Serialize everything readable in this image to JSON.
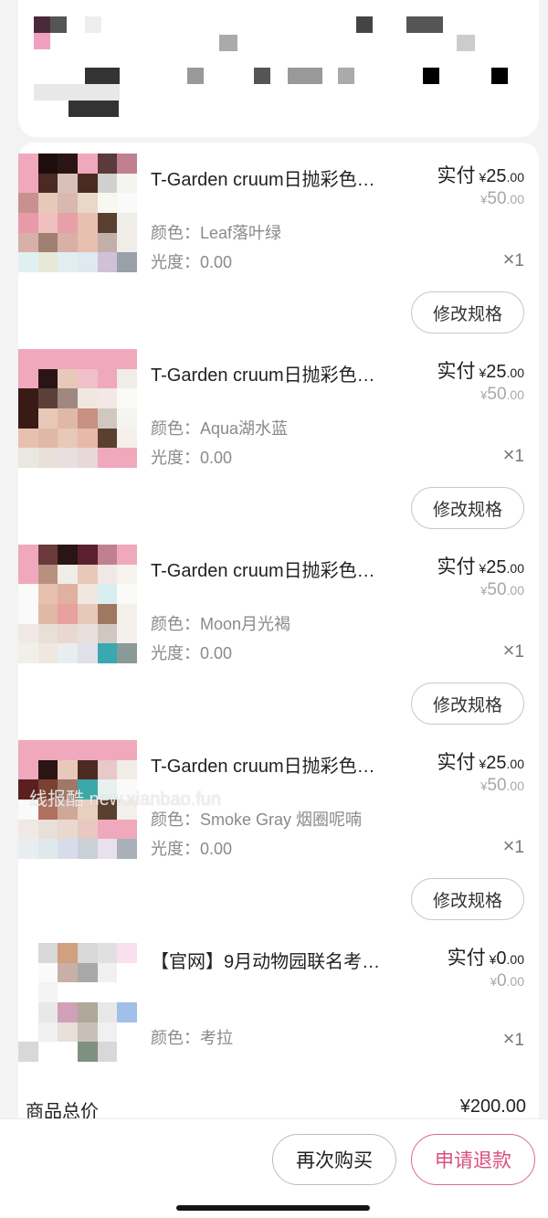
{
  "orders": [
    {
      "title": "T-Garden cruum日抛彩色…",
      "paid_label": "实付",
      "currency": "¥",
      "paid_int": "25",
      "paid_dec": ".00",
      "orig_int": "50",
      "orig_dec": ".00",
      "color_label": "颜色：",
      "color_value": "Leaf落叶绿",
      "power_label": "光度：",
      "power_value": "0.00",
      "qty_x": "×",
      "qty": "1",
      "modify_label": "修改规格"
    },
    {
      "title": "T-Garden cruum日抛彩色…",
      "paid_label": "实付",
      "currency": "¥",
      "paid_int": "25",
      "paid_dec": ".00",
      "orig_int": "50",
      "orig_dec": ".00",
      "color_label": "颜色：",
      "color_value": "Aqua湖水蓝",
      "power_label": "光度：",
      "power_value": "0.00",
      "qty_x": "×",
      "qty": "1",
      "modify_label": "修改规格"
    },
    {
      "title": "T-Garden cruum日抛彩色…",
      "paid_label": "实付",
      "currency": "¥",
      "paid_int": "25",
      "paid_dec": ".00",
      "orig_int": "50",
      "orig_dec": ".00",
      "color_label": "颜色：",
      "color_value": "Moon月光褐",
      "power_label": "光度：",
      "power_value": "0.00",
      "qty_x": "×",
      "qty": "1",
      "modify_label": "修改规格"
    },
    {
      "title": "T-Garden cruum日抛彩色…",
      "paid_label": "实付",
      "currency": "¥",
      "paid_int": "25",
      "paid_dec": ".00",
      "orig_int": "50",
      "orig_dec": ".00",
      "color_label": "颜色：",
      "color_value": "Smoke Gray 烟圈呢喃",
      "power_label": "光度：",
      "power_value": "0.00",
      "qty_x": "×",
      "qty": "1",
      "modify_label": "修改规格"
    },
    {
      "title": "【官网】9月动物园联名考…",
      "paid_label": "实付",
      "currency": "¥",
      "paid_int": "0",
      "paid_dec": ".00",
      "orig_int": "0",
      "orig_dec": ".00",
      "color_label": "颜色：",
      "color_value": "考拉",
      "qty_x": "×",
      "qty": "1"
    }
  ],
  "total": {
    "label": "商品总价",
    "value": "¥200.00"
  },
  "actions": {
    "rebuy_label": "再次购买",
    "refund_label": "申请退款"
  },
  "watermark": "线报酷 new.xianbao.fun",
  "colors": {
    "accent": "#d94f7a",
    "page_bg": "#f3f3f4",
    "muted_text": "#8a8a8a"
  }
}
